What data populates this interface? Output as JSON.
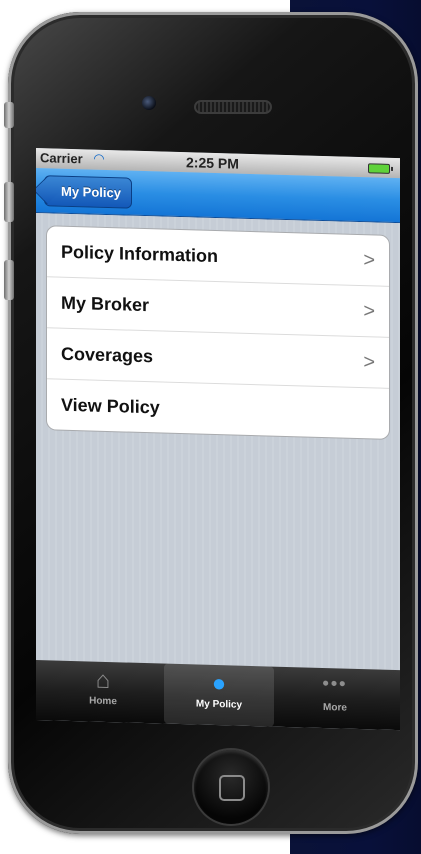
{
  "status_bar": {
    "carrier": "Carrier",
    "time": "2:25 PM"
  },
  "nav_bar": {
    "back_label": "My Policy"
  },
  "menu": [
    {
      "label": "Policy Information",
      "has_chevron": true
    },
    {
      "label": "My Broker",
      "has_chevron": true
    },
    {
      "label": "Coverages",
      "has_chevron": true
    },
    {
      "label": "View Policy",
      "has_chevron": false
    }
  ],
  "chevron": ">",
  "tabs": [
    {
      "label": "Home",
      "icon": "home-icon",
      "selected": false
    },
    {
      "label": "My Policy",
      "icon": "person-icon",
      "selected": true
    },
    {
      "label": "More",
      "icon": "more-icon",
      "selected": false
    }
  ],
  "colors": {
    "nav_bar": "#1f85de",
    "accent_selected_tab": "#2aa3ff",
    "background_strip": "#0a1238"
  }
}
